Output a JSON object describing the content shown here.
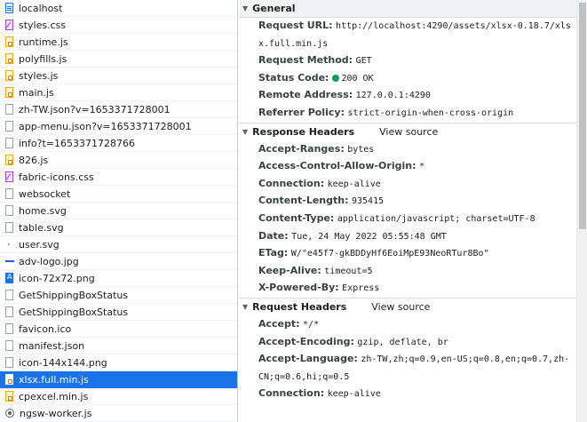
{
  "requests": [
    {
      "name": "localhost",
      "icon": "document-icon",
      "kind": "doc"
    },
    {
      "name": "styles.css",
      "icon": "stylesheet-icon",
      "kind": "css"
    },
    {
      "name": "runtime.js",
      "icon": "script-icon",
      "kind": "js"
    },
    {
      "name": "polyfills.js",
      "icon": "script-icon",
      "kind": "js"
    },
    {
      "name": "styles.js",
      "icon": "script-icon",
      "kind": "js"
    },
    {
      "name": "main.js",
      "icon": "script-icon",
      "kind": "js"
    },
    {
      "name": "zh-TW.json?v=1653371728001",
      "icon": "file-icon",
      "kind": "plain"
    },
    {
      "name": "app-menu.json?v=1653371728001",
      "icon": "file-icon",
      "kind": "plain"
    },
    {
      "name": "info?t=1653371728766",
      "icon": "file-icon",
      "kind": "plain"
    },
    {
      "name": "826.js",
      "icon": "script-icon",
      "kind": "js"
    },
    {
      "name": "fabric-icons.css",
      "icon": "stylesheet-icon",
      "kind": "css"
    },
    {
      "name": "websocket",
      "icon": "file-icon",
      "kind": "plain"
    },
    {
      "name": "home.svg",
      "icon": "file-icon",
      "kind": "plain"
    },
    {
      "name": "table.svg",
      "icon": "file-icon",
      "kind": "plain"
    },
    {
      "name": "user.svg",
      "icon": "dot-icon",
      "kind": "dot"
    },
    {
      "name": "adv-logo.jpg",
      "icon": "image-icon",
      "kind": "dash"
    },
    {
      "name": "icon-72x72.png",
      "icon": "image-icon",
      "kind": "img"
    },
    {
      "name": "GetShippingBoxStatus",
      "icon": "file-icon",
      "kind": "plain"
    },
    {
      "name": "GetShippingBoxStatus",
      "icon": "file-icon",
      "kind": "plain"
    },
    {
      "name": "favicon.ico",
      "icon": "file-icon",
      "kind": "plain"
    },
    {
      "name": "manifest.json",
      "icon": "file-icon",
      "kind": "plain"
    },
    {
      "name": "icon-144x144.png",
      "icon": "file-icon",
      "kind": "plain"
    },
    {
      "name": "xlsx.full.min.js",
      "icon": "script-icon",
      "kind": "js",
      "selected": true
    },
    {
      "name": "cpexcel.min.js",
      "icon": "script-icon",
      "kind": "js"
    },
    {
      "name": "ngsw-worker.js",
      "icon": "gear-icon",
      "kind": "gear"
    }
  ],
  "general": {
    "title": "General",
    "rows": [
      {
        "name": "Request URL:",
        "value": "http://localhost:4290/assets/xlsx-0.18.7/xlsx.full.min.js"
      },
      {
        "name": "Request Method:",
        "value": "GET"
      },
      {
        "name": "Status Code:",
        "value": "200 OK",
        "status_color": "#0f9d58"
      },
      {
        "name": "Remote Address:",
        "value": "127.0.0.1:4290"
      },
      {
        "name": "Referrer Policy:",
        "value": "strict-origin-when-cross-origin"
      }
    ]
  },
  "response_headers": {
    "title": "Response Headers",
    "view_source": "View source",
    "rows": [
      {
        "name": "Accept-Ranges:",
        "value": "bytes"
      },
      {
        "name": "Access-Control-Allow-Origin:",
        "value": "*"
      },
      {
        "name": "Connection:",
        "value": "keep-alive"
      },
      {
        "name": "Content-Length:",
        "value": "935415"
      },
      {
        "name": "Content-Type:",
        "value": "application/javascript; charset=UTF-8"
      },
      {
        "name": "Date:",
        "value": "Tue, 24 May 2022 05:55:48 GMT"
      },
      {
        "name": "ETag:",
        "value": "W/\"e45f7-gkBDDyHf6EoiMpE93NeoRTur8Bo\""
      },
      {
        "name": "Keep-Alive:",
        "value": "timeout=5"
      },
      {
        "name": "X-Powered-By:",
        "value": "Express"
      }
    ]
  },
  "request_headers": {
    "title": "Request Headers",
    "view_source": "View source",
    "rows": [
      {
        "name": "Accept:",
        "value": "*/*"
      },
      {
        "name": "Accept-Encoding:",
        "value": "gzip, deflate, br"
      },
      {
        "name": "Accept-Language:",
        "value": "zh-TW,zh;q=0.9,en-US;q=0.8,en;q=0.7,zh-CN;q=0.6,hi;q=0.5"
      },
      {
        "name": "Connection:",
        "value": "keep-alive"
      }
    ]
  },
  "colors": {
    "selected_row": "#1a73e8",
    "status_ok": "#0f9d58"
  }
}
